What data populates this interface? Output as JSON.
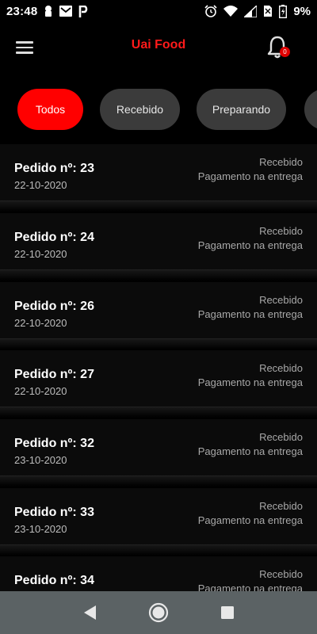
{
  "status_bar": {
    "time": "23:48",
    "battery_percent": "9%",
    "left_icons": [
      "lock-icon",
      "mail-icon",
      "paypal-icon"
    ],
    "right_icons": [
      "alarm-icon",
      "wifi-icon",
      "signal-icon",
      "no-sim-icon",
      "battery-charging-icon"
    ]
  },
  "app_bar": {
    "title": "Uai Food",
    "title_color": "#ff1a1a",
    "notification_badge": "0"
  },
  "filters": [
    {
      "label": "Todos",
      "active": true
    },
    {
      "label": "Recebido",
      "active": false
    },
    {
      "label": "Preparando",
      "active": false
    },
    {
      "label": "",
      "active": false
    }
  ],
  "orders": [
    {
      "title": "Pedido nº: 23",
      "date": "22-10-2020",
      "status": "Recebido",
      "payment": "Pagamento na entrega"
    },
    {
      "title": "Pedido nº: 24",
      "date": "22-10-2020",
      "status": "Recebido",
      "payment": "Pagamento na entrega"
    },
    {
      "title": "Pedido nº: 26",
      "date": "22-10-2020",
      "status": "Recebido",
      "payment": "Pagamento na entrega"
    },
    {
      "title": "Pedido nº: 27",
      "date": "22-10-2020",
      "status": "Recebido",
      "payment": "Pagamento na entrega"
    },
    {
      "title": "Pedido nº: 32",
      "date": "23-10-2020",
      "status": "Recebido",
      "payment": "Pagamento na entrega"
    },
    {
      "title": "Pedido nº: 33",
      "date": "23-10-2020",
      "status": "Recebido",
      "payment": "Pagamento na entrega"
    },
    {
      "title": "Pedido nº: 34",
      "date": "",
      "status": "Recebido",
      "payment": "Pagamento na entrega"
    }
  ],
  "nav_bar": {
    "buttons": [
      "back-icon",
      "home-icon",
      "recents-icon"
    ]
  },
  "colors": {
    "accent": "#ff0000",
    "chip_inactive": "#3b3b3b",
    "background": "#000000",
    "nav_bar": "#5b6264"
  }
}
